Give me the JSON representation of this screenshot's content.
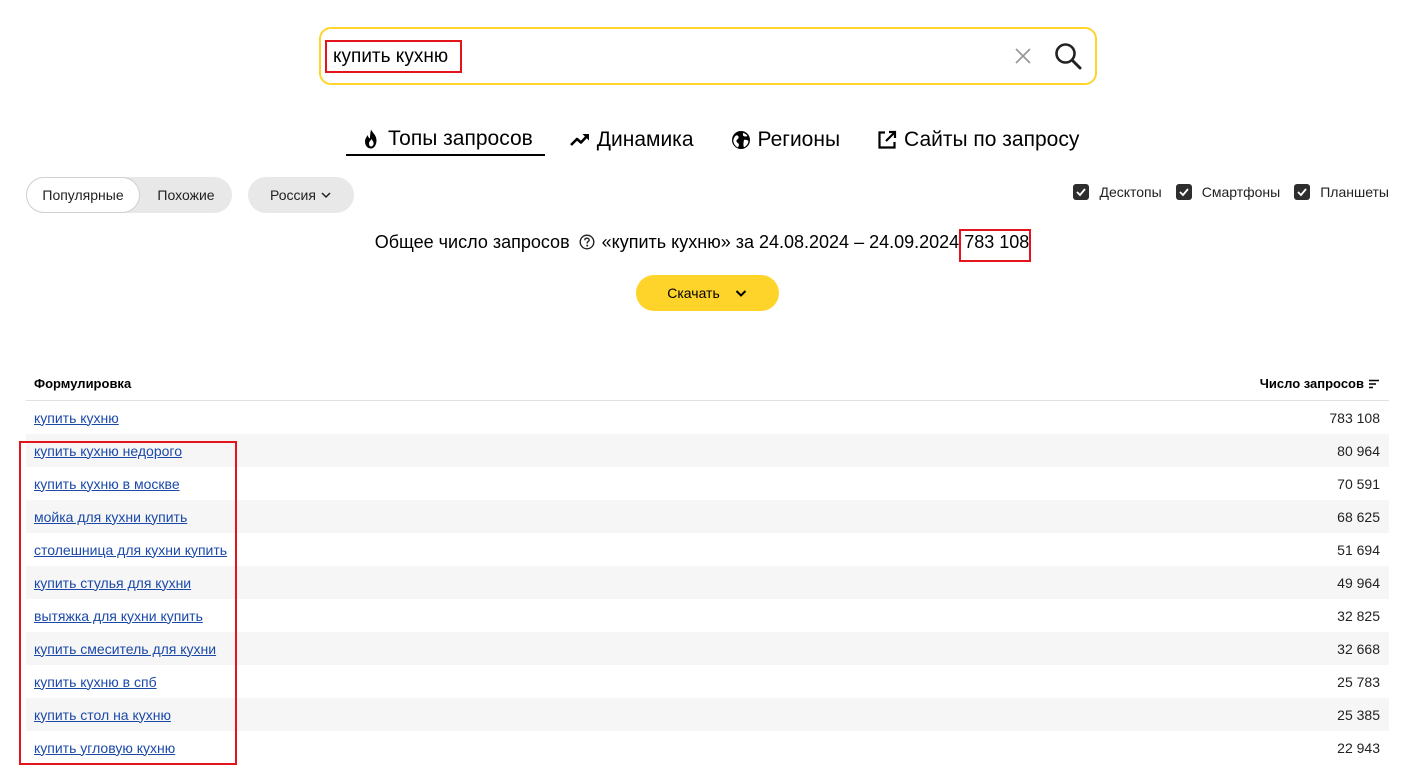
{
  "search": {
    "value": "купить кухню",
    "placeholder": ""
  },
  "tabs": [
    {
      "label": "Топы запросов",
      "icon": "flame-icon",
      "active": true
    },
    {
      "label": "Динамика",
      "icon": "trend-up-icon",
      "active": false
    },
    {
      "label": "Регионы",
      "icon": "globe-icon",
      "active": false
    },
    {
      "label": "Сайты по запросу",
      "icon": "external-link-icon",
      "active": false
    }
  ],
  "filters": {
    "mode_popular": "Популярные",
    "mode_similar": "Похожие",
    "region": "Россия",
    "devices": [
      "Десктопы",
      "Смартфоны",
      "Планшеты"
    ]
  },
  "summary": {
    "prefix": "Общее число запросов",
    "query": "«купить кухню» за 24.08.2024 – 24.09.2024",
    "total": "783 108"
  },
  "download_label": "Скачать",
  "table": {
    "col_phrase": "Формулировка",
    "col_count": "Число запросов",
    "rows": [
      {
        "phrase": "купить кухню",
        "count": "783 108"
      },
      {
        "phrase": "купить кухню недорого",
        "count": "80 964"
      },
      {
        "phrase": "купить кухню в москве",
        "count": "70 591"
      },
      {
        "phrase": "мойка для кухни купить",
        "count": "68 625"
      },
      {
        "phrase": "столешница для кухни купить",
        "count": "51 694"
      },
      {
        "phrase": "купить стулья для кухни",
        "count": "49 964"
      },
      {
        "phrase": "вытяжка для кухни купить",
        "count": "32 825"
      },
      {
        "phrase": "купить смеситель для кухни",
        "count": "32 668"
      },
      {
        "phrase": "купить кухню в спб",
        "count": "25 783"
      },
      {
        "phrase": "купить стол на кухню",
        "count": "25 385"
      },
      {
        "phrase": "купить угловую кухню",
        "count": "22 943"
      }
    ]
  },
  "colors": {
    "accent_yellow": "#fed42b",
    "link_blue": "#1b49a8",
    "highlight_red": "#e3141c"
  }
}
